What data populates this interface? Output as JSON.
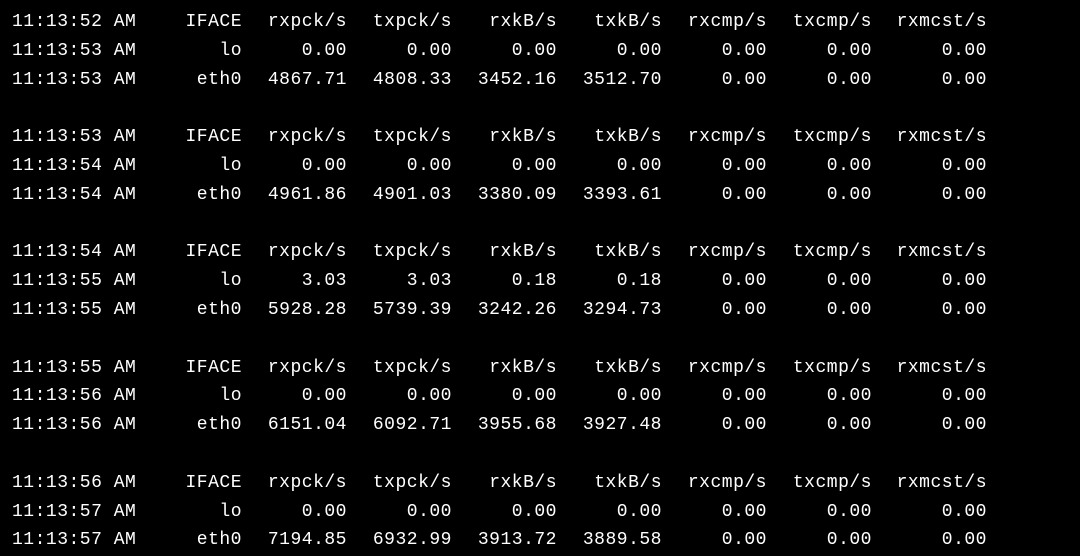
{
  "headers": {
    "iface": "IFACE",
    "rxpck": "rxpck/s",
    "txpck": "txpck/s",
    "rxkb": "rxkB/s",
    "txkb": "txkB/s",
    "rxcmp": "rxcmp/s",
    "txcmp": "txcmp/s",
    "rxmcst": "rxmcst/s"
  },
  "blocks": [
    {
      "header_time": "11:13:52 AM",
      "rows": [
        {
          "time": "11:13:53 AM",
          "iface": "lo",
          "rxpck": "0.00",
          "txpck": "0.00",
          "rxkb": "0.00",
          "txkb": "0.00",
          "rxcmp": "0.00",
          "txcmp": "0.00",
          "rxmcst": "0.00"
        },
        {
          "time": "11:13:53 AM",
          "iface": "eth0",
          "rxpck": "4867.71",
          "txpck": "4808.33",
          "rxkb": "3452.16",
          "txkb": "3512.70",
          "rxcmp": "0.00",
          "txcmp": "0.00",
          "rxmcst": "0.00"
        }
      ]
    },
    {
      "header_time": "11:13:53 AM",
      "rows": [
        {
          "time": "11:13:54 AM",
          "iface": "lo",
          "rxpck": "0.00",
          "txpck": "0.00",
          "rxkb": "0.00",
          "txkb": "0.00",
          "rxcmp": "0.00",
          "txcmp": "0.00",
          "rxmcst": "0.00"
        },
        {
          "time": "11:13:54 AM",
          "iface": "eth0",
          "rxpck": "4961.86",
          "txpck": "4901.03",
          "rxkb": "3380.09",
          "txkb": "3393.61",
          "rxcmp": "0.00",
          "txcmp": "0.00",
          "rxmcst": "0.00"
        }
      ]
    },
    {
      "header_time": "11:13:54 AM",
      "rows": [
        {
          "time": "11:13:55 AM",
          "iface": "lo",
          "rxpck": "3.03",
          "txpck": "3.03",
          "rxkb": "0.18",
          "txkb": "0.18",
          "rxcmp": "0.00",
          "txcmp": "0.00",
          "rxmcst": "0.00"
        },
        {
          "time": "11:13:55 AM",
          "iface": "eth0",
          "rxpck": "5928.28",
          "txpck": "5739.39",
          "rxkb": "3242.26",
          "txkb": "3294.73",
          "rxcmp": "0.00",
          "txcmp": "0.00",
          "rxmcst": "0.00"
        }
      ]
    },
    {
      "header_time": "11:13:55 AM",
      "rows": [
        {
          "time": "11:13:56 AM",
          "iface": "lo",
          "rxpck": "0.00",
          "txpck": "0.00",
          "rxkb": "0.00",
          "txkb": "0.00",
          "rxcmp": "0.00",
          "txcmp": "0.00",
          "rxmcst": "0.00"
        },
        {
          "time": "11:13:56 AM",
          "iface": "eth0",
          "rxpck": "6151.04",
          "txpck": "6092.71",
          "rxkb": "3955.68",
          "txkb": "3927.48",
          "rxcmp": "0.00",
          "txcmp": "0.00",
          "rxmcst": "0.00"
        }
      ]
    },
    {
      "header_time": "11:13:56 AM",
      "rows": [
        {
          "time": "11:13:57 AM",
          "iface": "lo",
          "rxpck": "0.00",
          "txpck": "0.00",
          "rxkb": "0.00",
          "txkb": "0.00",
          "rxcmp": "0.00",
          "txcmp": "0.00",
          "rxmcst": "0.00"
        },
        {
          "time": "11:13:57 AM",
          "iface": "eth0",
          "rxpck": "7194.85",
          "txpck": "6932.99",
          "rxkb": "3913.72",
          "txkb": "3889.58",
          "rxcmp": "0.00",
          "txcmp": "0.00",
          "rxmcst": "0.00"
        }
      ]
    }
  ]
}
